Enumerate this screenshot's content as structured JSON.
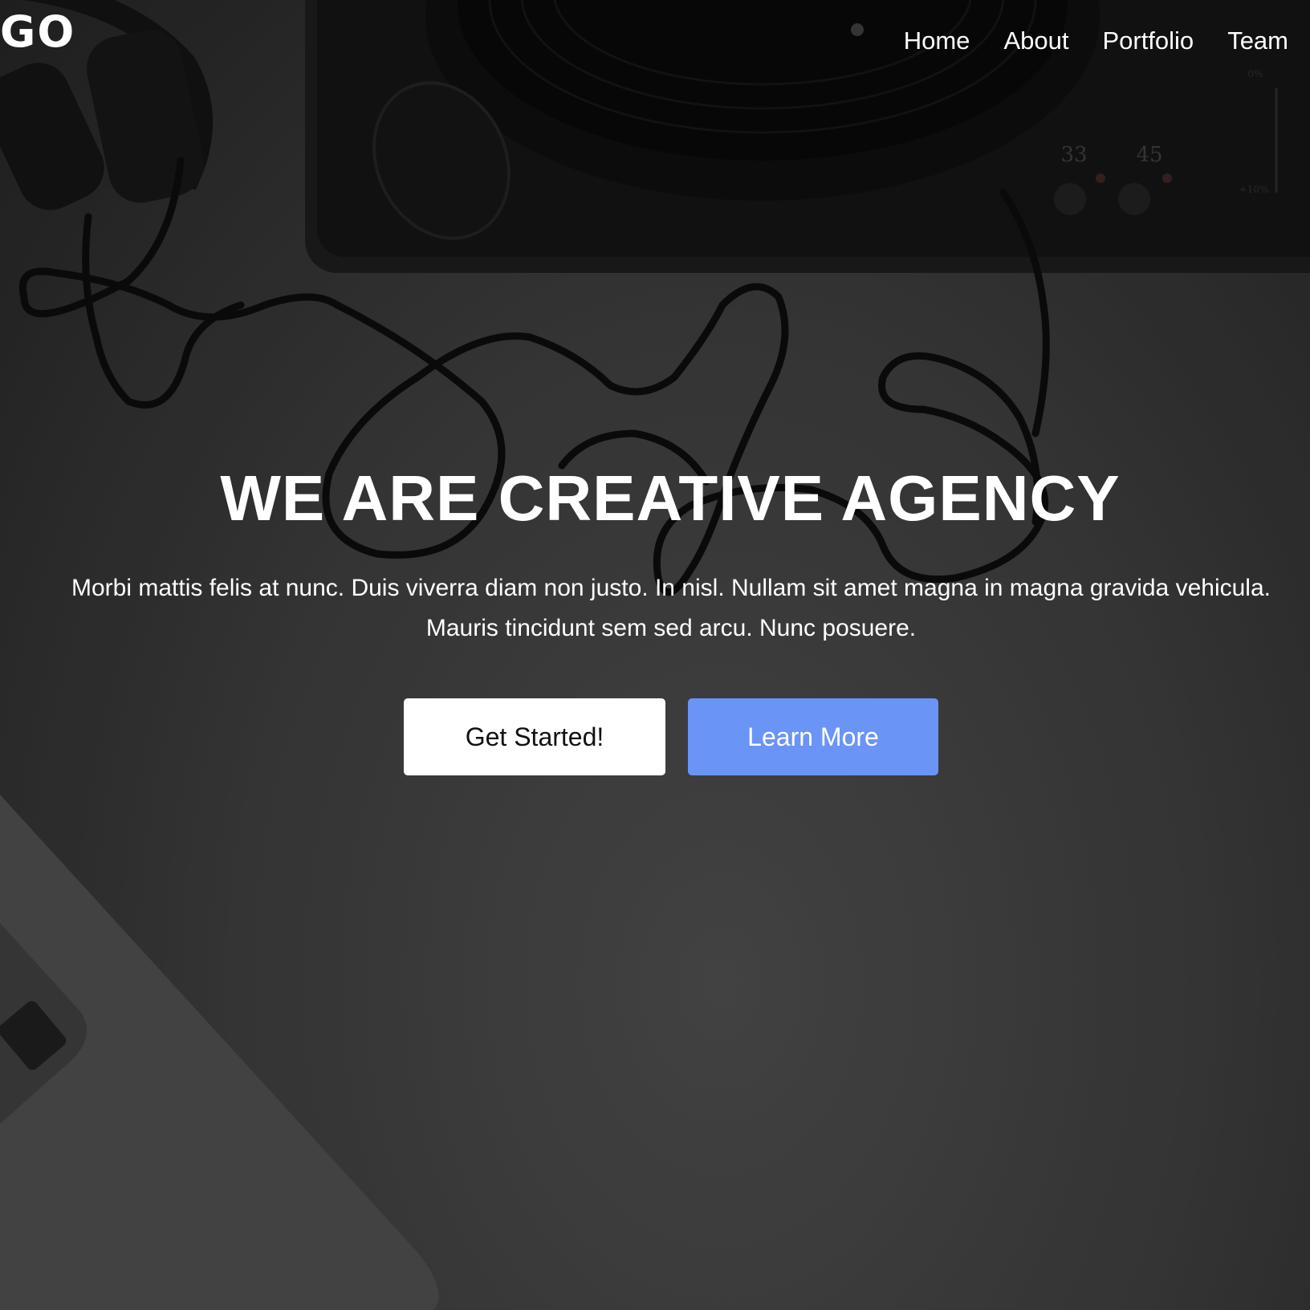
{
  "header": {
    "logo_text": "GO",
    "nav": {
      "home": "Home",
      "about": "About",
      "portfolio": "Portfolio",
      "team": "Team"
    }
  },
  "hero": {
    "headline": "WE ARE CREATIVE AGENCY",
    "subtext_line1": "Morbi mattis felis at nunc. Duis viverra diam non justo. In nisl. Nullam sit amet magna in magna gravida vehicula.",
    "subtext_line2": "Mauris tincidunt sem sed arcu. Nunc posuere.",
    "primary_button": "Get Started!",
    "secondary_button": "Learn More",
    "turntable_speed_labels": [
      "33",
      "45"
    ],
    "pitch_labels": [
      "0%",
      "+10%"
    ]
  },
  "colors": {
    "accent": "#6b94f7",
    "text": "#ffffff",
    "primary_button_bg": "#ffffff"
  }
}
